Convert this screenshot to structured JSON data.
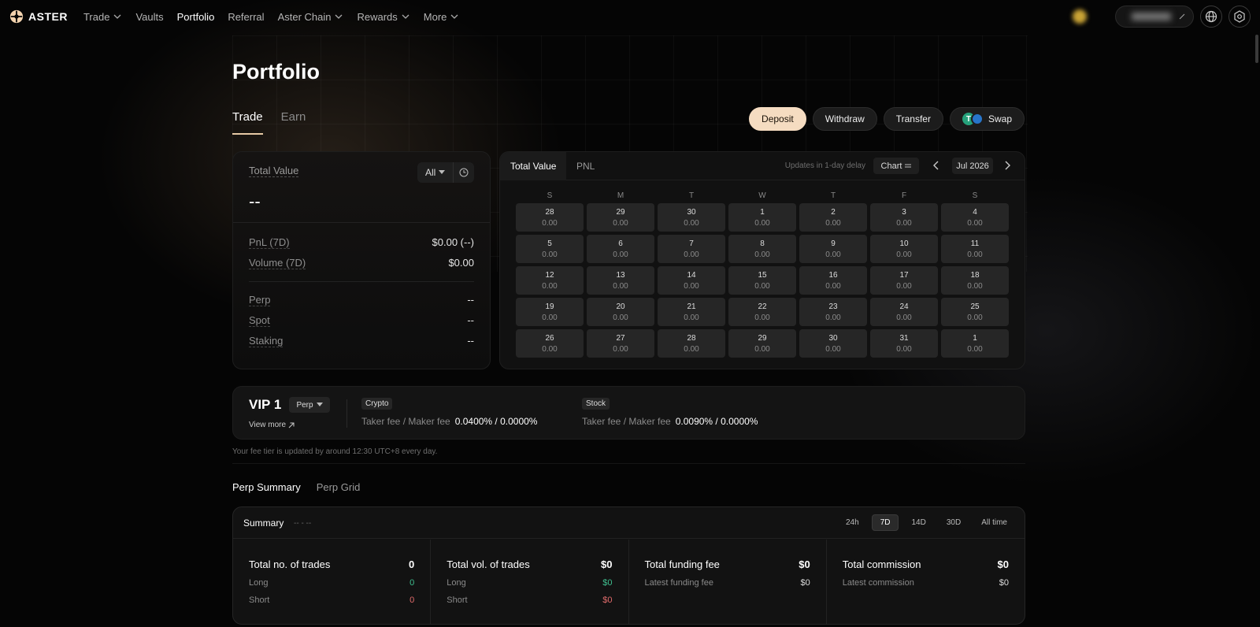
{
  "nav": {
    "logo": "ASTER",
    "items": [
      {
        "label": "Trade",
        "dropdown": true,
        "active": false
      },
      {
        "label": "Vaults",
        "dropdown": false,
        "active": false
      },
      {
        "label": "Portfolio",
        "dropdown": false,
        "active": true
      },
      {
        "label": "Referral",
        "dropdown": false,
        "active": false
      },
      {
        "label": "Aster Chain",
        "dropdown": true,
        "active": false
      },
      {
        "label": "Rewards",
        "dropdown": true,
        "active": false
      },
      {
        "label": "More",
        "dropdown": true,
        "active": false
      }
    ]
  },
  "page": {
    "title": "Portfolio",
    "tabs": [
      "Trade",
      "Earn"
    ],
    "active_tab": "Trade"
  },
  "actions": {
    "deposit": "Deposit",
    "withdraw": "Withdraw",
    "transfer": "Transfer",
    "swap": "Swap"
  },
  "overview": {
    "total_value_label": "Total Value",
    "range": "All",
    "total_value": "--",
    "pnl_label": "PnL (7D)",
    "pnl_value": "$0.00 (--)",
    "volume_label": "Volume (7D)",
    "volume_value": "$0.00",
    "perp_label": "Perp",
    "perp_value": "--",
    "spot_label": "Spot",
    "spot_value": "--",
    "staking_label": "Staking",
    "staking_value": "--"
  },
  "calendar": {
    "tabs": [
      "Total Value",
      "PNL"
    ],
    "active_tab": "Total Value",
    "delay_note": "Updates in 1-day delay",
    "chart_label": "Chart",
    "month": "Jul 2026",
    "weekdays": [
      "S",
      "M",
      "T",
      "W",
      "T",
      "F",
      "S"
    ],
    "days": [
      {
        "d": "28",
        "v": "0.00"
      },
      {
        "d": "29",
        "v": "0.00"
      },
      {
        "d": "30",
        "v": "0.00"
      },
      {
        "d": "1",
        "v": "0.00"
      },
      {
        "d": "2",
        "v": "0.00"
      },
      {
        "d": "3",
        "v": "0.00"
      },
      {
        "d": "4",
        "v": "0.00"
      },
      {
        "d": "5",
        "v": "0.00"
      },
      {
        "d": "6",
        "v": "0.00"
      },
      {
        "d": "7",
        "v": "0.00"
      },
      {
        "d": "8",
        "v": "0.00"
      },
      {
        "d": "9",
        "v": "0.00"
      },
      {
        "d": "10",
        "v": "0.00"
      },
      {
        "d": "11",
        "v": "0.00"
      },
      {
        "d": "12",
        "v": "0.00"
      },
      {
        "d": "13",
        "v": "0.00"
      },
      {
        "d": "14",
        "v": "0.00"
      },
      {
        "d": "15",
        "v": "0.00"
      },
      {
        "d": "16",
        "v": "0.00"
      },
      {
        "d": "17",
        "v": "0.00"
      },
      {
        "d": "18",
        "v": "0.00"
      },
      {
        "d": "19",
        "v": "0.00"
      },
      {
        "d": "20",
        "v": "0.00"
      },
      {
        "d": "21",
        "v": "0.00"
      },
      {
        "d": "22",
        "v": "0.00"
      },
      {
        "d": "23",
        "v": "0.00"
      },
      {
        "d": "24",
        "v": "0.00"
      },
      {
        "d": "25",
        "v": "0.00"
      },
      {
        "d": "26",
        "v": "0.00"
      },
      {
        "d": "27",
        "v": "0.00"
      },
      {
        "d": "28",
        "v": "0.00"
      },
      {
        "d": "29",
        "v": "0.00"
      },
      {
        "d": "30",
        "v": "0.00"
      },
      {
        "d": "31",
        "v": "0.00"
      },
      {
        "d": "1",
        "v": "0.00"
      }
    ]
  },
  "vip": {
    "level": "VIP 1",
    "market": "Perp",
    "view_more": "View more",
    "crypto_label": "Crypto",
    "crypto_fee_label": "Taker fee / Maker fee",
    "crypto_fee": "0.0400% / 0.0000%",
    "stock_label": "Stock",
    "stock_fee_label": "Taker fee / Maker fee",
    "stock_fee": "0.0090% / 0.0000%",
    "note": "Your fee tier is updated by around 12:30 UTC+8 every day."
  },
  "perp": {
    "tabs": [
      "Perp Summary",
      "Perp Grid"
    ],
    "active_tab": "Perp Summary",
    "summary_title": "Summary",
    "summary_range_text": "-- - --",
    "ranges": [
      "24h",
      "7D",
      "14D",
      "30D",
      "All time"
    ],
    "active_range": "7D",
    "trades_label": "Total no. of trades",
    "trades_value": "0",
    "trades_long_label": "Long",
    "trades_long_value": "0",
    "trades_short_label": "Short",
    "trades_short_value": "0",
    "vol_label": "Total vol. of trades",
    "vol_value": "$0",
    "vol_long_label": "Long",
    "vol_long_value": "$0",
    "vol_short_label": "Short",
    "vol_short_value": "$0",
    "funding_label": "Total funding fee",
    "funding_value": "$0",
    "latest_funding_label": "Latest funding fee",
    "latest_funding_value": "$0",
    "commission_label": "Total commission",
    "commission_value": "$0",
    "latest_commission_label": "Latest commission",
    "latest_commission_value": "$0"
  },
  "colors": {
    "accent": "#f5dcc1",
    "positive": "#3fbf8f",
    "negative": "#e06b6b"
  }
}
